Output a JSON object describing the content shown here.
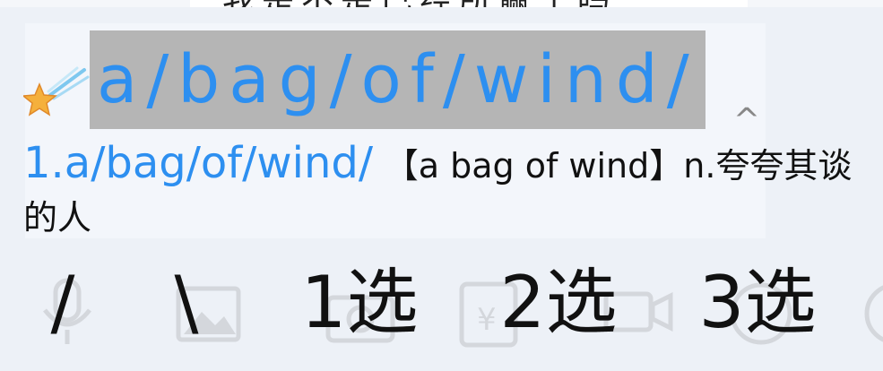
{
  "chat": {
    "top_message_partial": "我是不是已经所赢了吗"
  },
  "ime": {
    "composition_text": "a/bag/of/wind/",
    "collapse_symbol": "^",
    "candidate": {
      "word": "1.a/bag/of/wind/",
      "definition": "【a bag of wind】n.夸夸其谈的人"
    },
    "keys": [
      "/",
      "\\",
      "1选",
      "2选",
      "3选"
    ],
    "toolbar_icons": [
      "mic-icon",
      "image-icon",
      "camera-icon",
      "red-packet-icon",
      "video-icon",
      "emoji-icon",
      "more-icon"
    ]
  },
  "colors": {
    "accent": "#2d8ff0",
    "selection_bg": "#b5b5b5",
    "panel_bg": "#edf1f7"
  }
}
